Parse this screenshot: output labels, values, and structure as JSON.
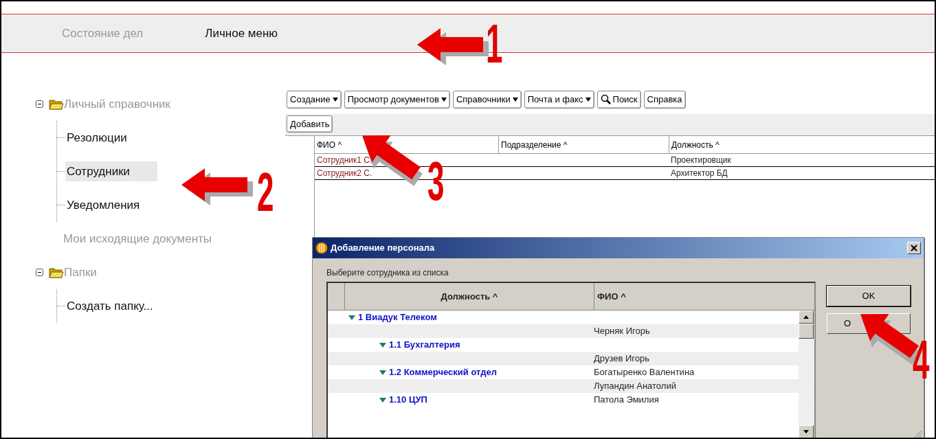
{
  "top_tabs": [
    {
      "label": "Состояние дел",
      "selected": false
    },
    {
      "label": "Личное меню",
      "selected": true
    }
  ],
  "sidebar": {
    "items": [
      {
        "kind": "folder",
        "label": "Личный справочник",
        "expanded": true,
        "children": [
          {
            "label": "Резолюции",
            "selected": false
          },
          {
            "label": "Сотрудники",
            "selected": true
          },
          {
            "label": "Уведомления",
            "selected": false
          }
        ]
      },
      {
        "kind": "heading",
        "label": "Мои исходящие документы"
      },
      {
        "kind": "folder",
        "label": "Папки",
        "expanded": true,
        "children": [
          {
            "label": "Создать папку...",
            "selected": false
          }
        ]
      }
    ]
  },
  "toolbar": [
    {
      "label": "Создание",
      "kind": "dropdown"
    },
    {
      "label": "Просмотр документов",
      "kind": "dropdown"
    },
    {
      "label": "Справочники",
      "kind": "dropdown"
    },
    {
      "label": "Почта и факс",
      "kind": "dropdown"
    },
    {
      "label": "Поиск",
      "kind": "search"
    },
    {
      "label": "Справка",
      "kind": "plain"
    }
  ],
  "add_button": "Добавить",
  "table": {
    "columns": [
      "ФИО ^",
      "Подразделение ^",
      "Должность ^"
    ],
    "rows": [
      {
        "fio": "Сотрудник1 С.",
        "position": "Проектировщик",
        "selected": false
      },
      {
        "fio": "Сотрудник2 С.",
        "position": "Архитектор БД",
        "selected": true
      }
    ]
  },
  "dialog": {
    "title": "Добавление персонала",
    "prompt": "Выберите сотрудника из списка",
    "columns": [
      "Должность ^",
      "ФИО ^"
    ],
    "rows": [
      {
        "kind": "group",
        "label": "1 Виадук Телеком",
        "expanded": true,
        "children": [
          {
            "kind": "person",
            "fio": "Черняк Игорь"
          },
          {
            "kind": "group",
            "label": "1.1 Бухгалтерия",
            "expanded": true,
            "children": [
              {
                "kind": "person",
                "fio": "Друзев Игорь"
              }
            ]
          },
          {
            "kind": "group",
            "label": "1.2 Коммерческий отдел",
            "fio": "Богатыренко Валентина",
            "expanded": true,
            "children": [
              {
                "kind": "person",
                "fio": "Лупандин Анатолий"
              }
            ]
          },
          {
            "kind": "group",
            "label": "1.10 ЦУП",
            "fio": "Патола Эмилия",
            "expanded": true
          }
        ]
      }
    ],
    "ok_button": "OK",
    "cancel_button": "О"
  },
  "callouts": [
    "1",
    "2",
    "3",
    "4"
  ]
}
